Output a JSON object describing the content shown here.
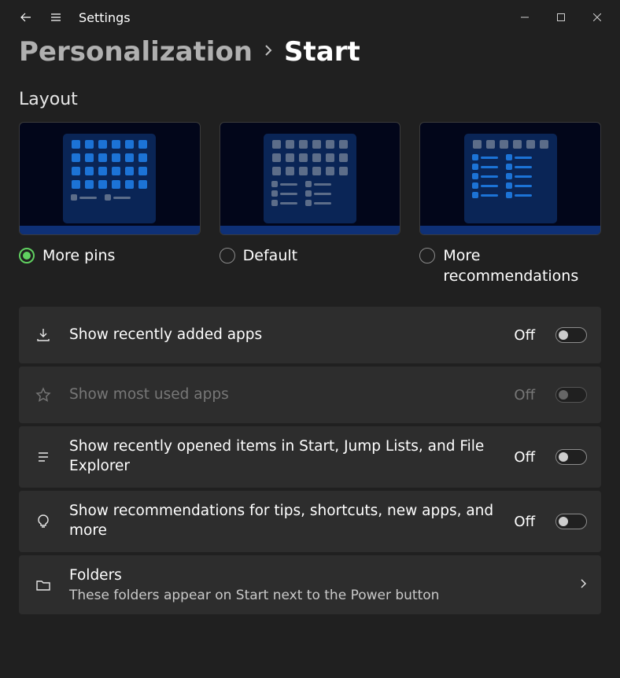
{
  "window": {
    "title": "Settings"
  },
  "breadcrumb": {
    "parent": "Personalization",
    "current": "Start"
  },
  "section": {
    "layout_title": "Layout"
  },
  "layout_options": {
    "more_pins": "More pins",
    "default": "Default",
    "more_recs": "More recommendations",
    "selected": "more_pins"
  },
  "settings": {
    "recent_apps": {
      "title": "Show recently added apps",
      "state": "Off"
    },
    "most_used": {
      "title": "Show most used apps",
      "state": "Off"
    },
    "recent_items": {
      "title": "Show recently opened items in Start, Jump Lists, and File Explorer",
      "state": "Off"
    },
    "tips": {
      "title": "Show recommendations for tips, shortcuts, new apps, and more",
      "state": "Off"
    },
    "folders": {
      "title": "Folders",
      "sub": "These folders appear on Start next to the Power button"
    }
  }
}
